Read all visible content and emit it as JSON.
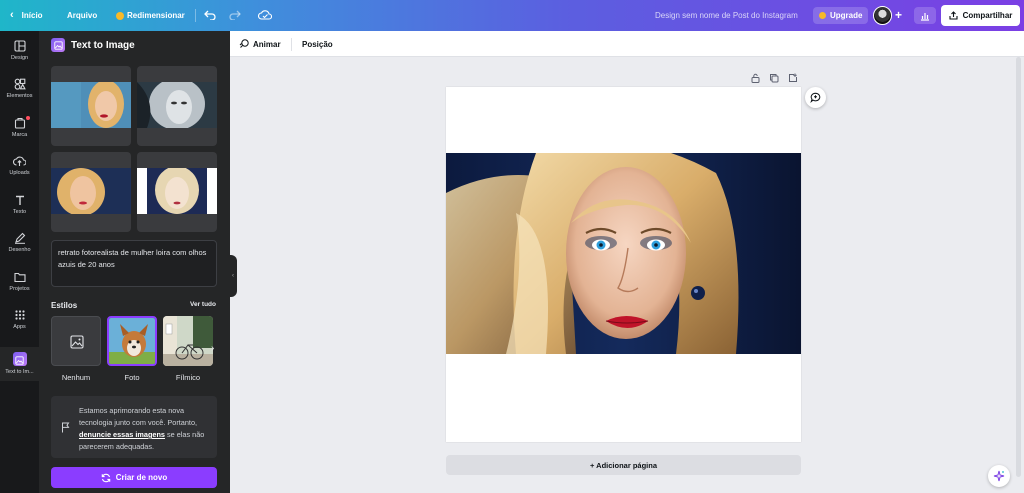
{
  "topbar": {
    "home_label": "Início",
    "file_label": "Arquivo",
    "resize_label": "Redimensionar",
    "design_title": "Design sem nome de Post do Instagram",
    "upgrade_label": "Upgrade",
    "share_label": "Compartilhar"
  },
  "rail": {
    "items": [
      {
        "label": "Design",
        "icon": "layout-icon"
      },
      {
        "label": "Elementos",
        "icon": "shapes-icon"
      },
      {
        "label": "Marca",
        "icon": "brand-icon"
      },
      {
        "label": "Uploads",
        "icon": "cloud-upload-icon"
      },
      {
        "label": "Texto",
        "icon": "text-icon"
      },
      {
        "label": "Desenho",
        "icon": "pen-icon"
      },
      {
        "label": "Projetos",
        "icon": "folder-icon"
      },
      {
        "label": "Apps",
        "icon": "grid-icon"
      },
      {
        "label": "Text to Im...",
        "icon": "text-to-image-app-icon"
      }
    ]
  },
  "panel": {
    "title": "Text to Image",
    "prompt": "retrato fotorealista de mulher loira com olhos azuis de 20 anos",
    "styles_label": "Estilos",
    "see_all_label": "Ver tudo",
    "styles": [
      {
        "name": "Nenhum"
      },
      {
        "name": "Foto"
      },
      {
        "name": "Fílmico"
      }
    ],
    "notice_text_1": "Estamos aprimorando esta nova tecnologia junto com você. Portanto, ",
    "notice_link": "denuncie essas imagens",
    "notice_text_2": " se elas não parecerem adequadas.",
    "create_label": "Criar de novo"
  },
  "context_toolbar": {
    "animate_label": "Animar",
    "position_label": "Posição"
  },
  "canvas": {
    "add_page_label": "+ Adicionar página"
  },
  "colors": {
    "accent": "#8b3dff",
    "rail_bg": "#18191b",
    "panel_bg": "#252627",
    "canvas_bg": "#ebecf0"
  }
}
